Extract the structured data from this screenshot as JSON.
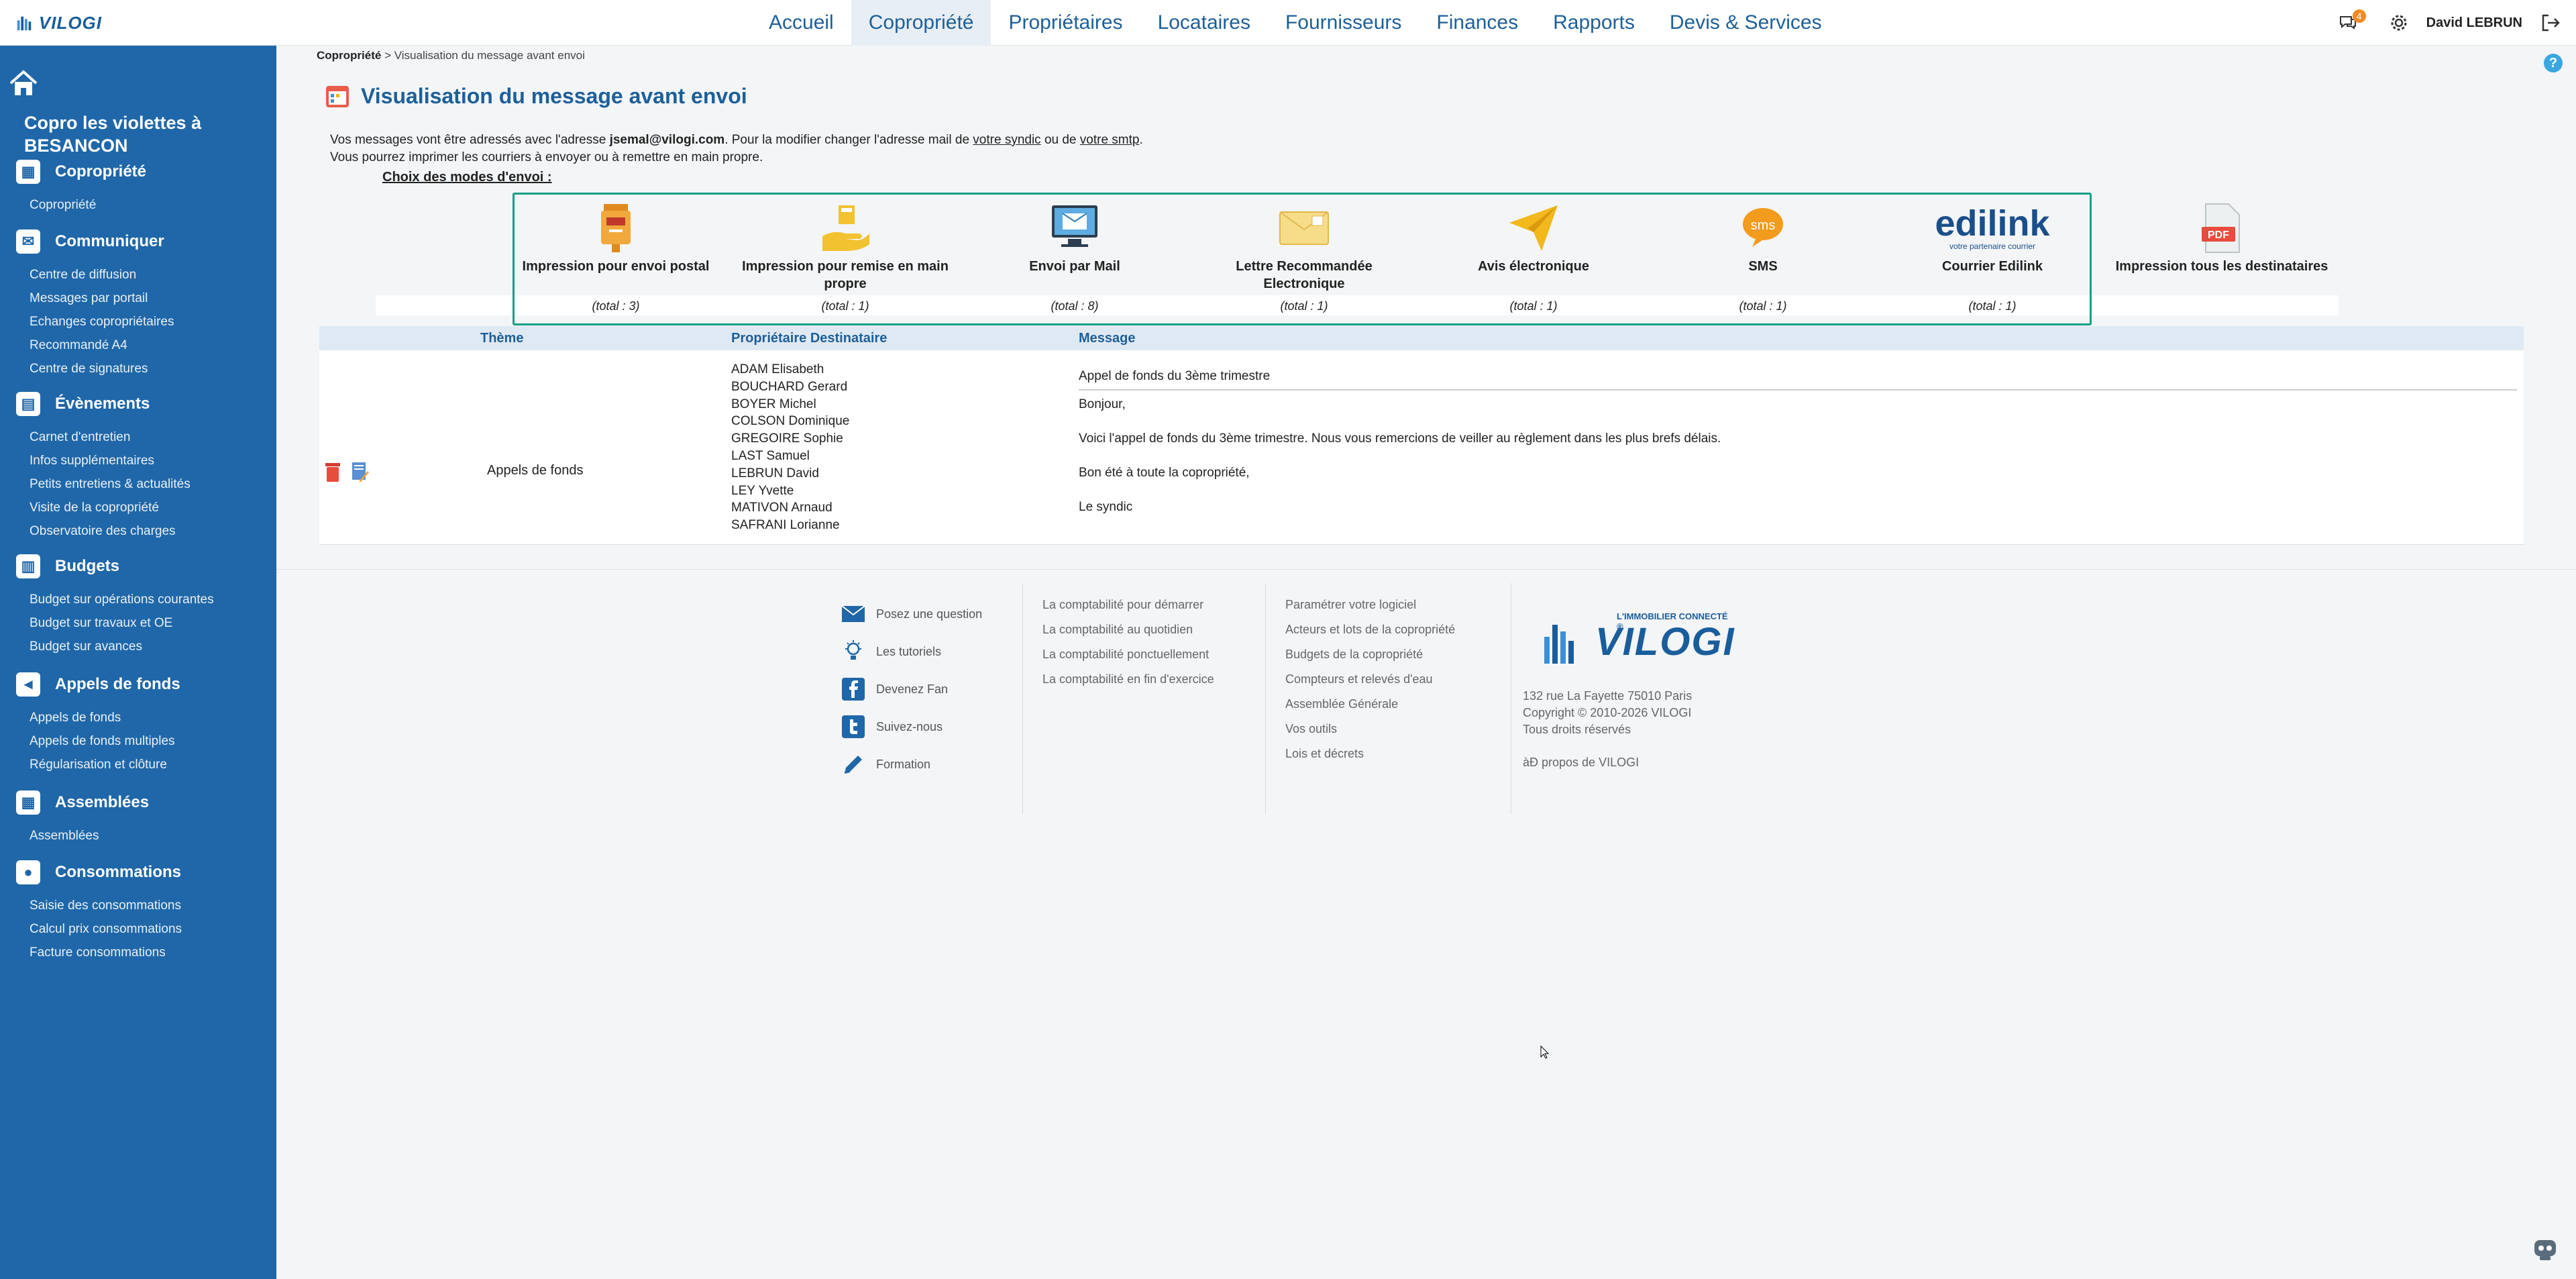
{
  "app": {
    "logo_text": "VILOGI"
  },
  "nav": {
    "items": [
      "Accueil",
      "Copropriété",
      "Propriétaires",
      "Locataires",
      "Fournisseurs",
      "Finances",
      "Rapports",
      "Devis & Services"
    ],
    "active_index": 1
  },
  "user": {
    "name": "David LEBRUN",
    "notifications": "4"
  },
  "sidebar": {
    "copro_title": "Copro les violettes à BESANCON",
    "sections": [
      {
        "label": "Copropriété",
        "icon": "grid-icon",
        "items": [
          "Copropriété"
        ]
      },
      {
        "label": "Communiquer",
        "icon": "envelope-icon",
        "items": [
          "Centre de diffusion",
          "Messages par portail",
          "Echanges copropriétaires",
          "Recommandé A4",
          "Centre de signatures"
        ]
      },
      {
        "label": "Évènements",
        "icon": "calendar-icon",
        "items": [
          "Carnet d'entretien",
          "Infos supplémentaires",
          "Petits entretiens & actualités",
          "Visite de la copropriété",
          "Observatoire des charges"
        ]
      },
      {
        "label": "Budgets",
        "icon": "calculator-icon",
        "items": [
          "Budget sur opérations courantes",
          "Budget sur travaux et OE",
          "Budget sur avances"
        ]
      },
      {
        "label": "Appels de fonds",
        "icon": "megaphone-icon",
        "items": [
          "Appels de fonds",
          "Appels de fonds multiples",
          "Régularisation et clôture"
        ]
      },
      {
        "label": "Assemblées",
        "icon": "grid-icon",
        "items": [
          "Assemblées"
        ]
      },
      {
        "label": "Consommations",
        "icon": "drop-icon",
        "items": [
          "Saisie des consommations",
          "Calcul prix consommations",
          "Facture consommations"
        ]
      }
    ]
  },
  "breadcrumb": {
    "root": "Copropriété",
    "sep": ">",
    "current": "Visualisation du message avant envoi"
  },
  "page": {
    "title": "Visualisation du message avant envoi",
    "info_line1_a": "Vos messages vont être adressés avec l'adresse ",
    "info_email": "jsemal@vilogi.com",
    "info_line1_b": ". Pour la modifier changer l'adresse mail de ",
    "info_link1": "votre syndic",
    "info_line1_c": " ou de ",
    "info_link2": "votre smtp",
    "info_line1_d": ".",
    "info_line2": "Vous pourrez imprimer les courriers à envoyer ou à remettre en main propre.",
    "choice_label": "Choix des modes d'envoi :"
  },
  "modes": [
    {
      "label": "Impression pour envoi postal",
      "total": "(total : 3)",
      "icon": "mailbox-icon"
    },
    {
      "label": "Impression pour remise en main propre",
      "total": "(total : 1)",
      "icon": "hand-delivery-icon"
    },
    {
      "label": "Envoi par Mail",
      "total": "(total : 8)",
      "icon": "computer-mail-icon"
    },
    {
      "label": "Lettre Recommandée Electronique",
      "total": "(total : 1)",
      "icon": "registered-letter-icon"
    },
    {
      "label": "Avis électronique",
      "total": "(total : 1)",
      "icon": "paper-plane-icon"
    },
    {
      "label": "SMS",
      "total": "(total : 1)",
      "icon": "sms-icon"
    },
    {
      "label": "Courrier Edilink",
      "total": "(total : 1)",
      "icon": "edilink-logo-icon",
      "logo_text": "edilink",
      "logo_sub": "votre partenaire courrier"
    },
    {
      "label": "Impression tous les destinataires",
      "total": "",
      "icon": "pdf-icon",
      "pdf_text": "PDF"
    }
  ],
  "table": {
    "headers": {
      "theme": "Thème",
      "recipients": "Propriétaire Destinataire",
      "message": "Message"
    },
    "row": {
      "theme": "Appels de fonds",
      "recipients": [
        "ADAM Elisabeth",
        "BOUCHARD Gerard",
        "BOYER Michel",
        "COLSON Dominique",
        "GREGOIRE Sophie",
        "LAST Samuel",
        "LEBRUN David",
        "LEY Yvette",
        "MATIVON Arnaud",
        "SAFRANI Lorianne"
      ],
      "subject": "Appel de fonds du 3ème trimestre",
      "body": [
        "Bonjour,",
        "Voici l'appel de fonds du 3ème trimestre. Nous vous remercions de veiller au règlement dans les plus brefs délais.",
        "Bon été à toute la copropriété,",
        "Le syndic"
      ]
    }
  },
  "footer": {
    "help_links": [
      {
        "label": "Posez une question",
        "icon": "envelope-icon"
      },
      {
        "label": "Les tutoriels",
        "icon": "lightbulb-icon"
      },
      {
        "label": "Devenez Fan",
        "icon": "facebook-icon"
      },
      {
        "label": "Suivez-nous",
        "icon": "twitter-icon"
      },
      {
        "label": "Formation",
        "icon": "pencil-icon"
      }
    ],
    "compta_links": [
      "La comptabilité pour démarrer",
      "La comptabilité au quotidien",
      "La comptabilité ponctuellement",
      "La comptabilité en fin d'exercice"
    ],
    "settings_links": [
      "Paramétrer votre logiciel",
      "Acteurs et lots de la copropriété",
      "Budgets de la copropriété",
      "Compteurs et relevés d'eau",
      "Assemblée Générale",
      "Vos outils",
      "Lois et décrets"
    ],
    "logo_tagline": "L'IMMOBILIER CONNECTÉ ®",
    "logo_text": "VILOGI",
    "address": "132 rue La Fayette 75010 Paris",
    "copyright": "Copyright © 2010-2026 VILOGI",
    "rights": "Tous droits réservés",
    "about": "àÐ propos de VILOGI"
  },
  "colors": {
    "brand": "#1f67a8",
    "accent_frame": "#16a085",
    "badge": "#f08a24"
  }
}
